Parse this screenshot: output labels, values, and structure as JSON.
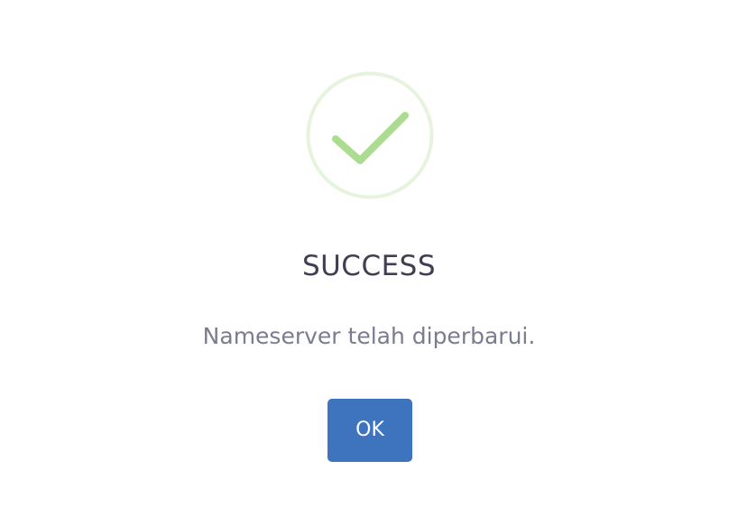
{
  "dialog": {
    "icon": "checkmark-success-icon",
    "title": "SUCCESS",
    "message": "Nameserver telah diperbarui.",
    "ok_label": "OK"
  },
  "colors": {
    "title": "#3f3f51",
    "message": "#7b7b92",
    "button": "#3e73bd",
    "check": "#acdc8f",
    "ring": "#e6f4dd"
  }
}
